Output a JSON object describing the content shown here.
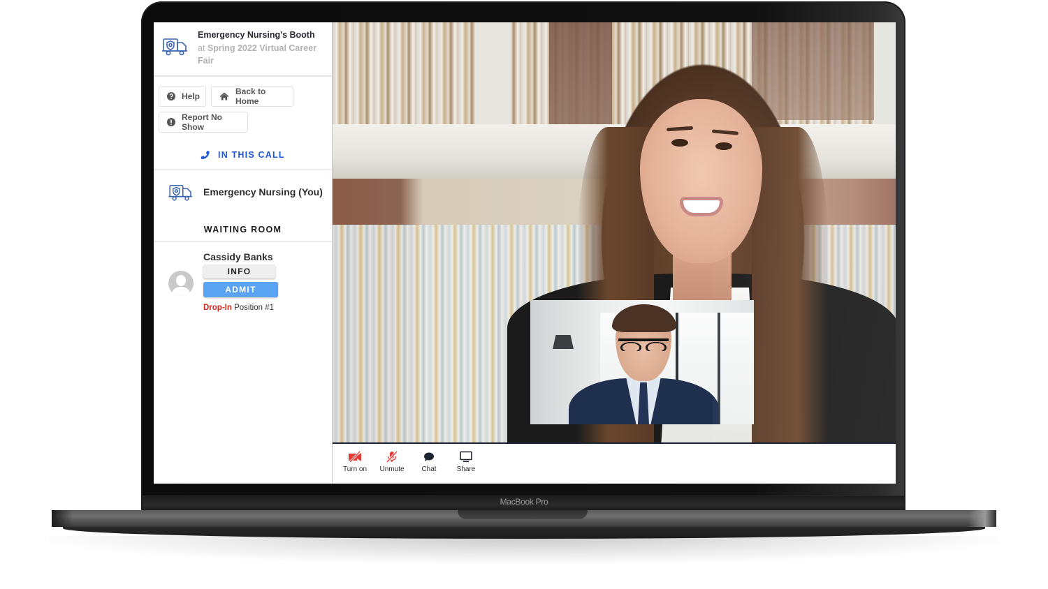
{
  "device": {
    "brand_label": "MacBook Pro"
  },
  "sidebar": {
    "booth": {
      "title": "Emergency Nursing's Booth",
      "subtitle_prefix": "at",
      "event_name": "Spring 2022 Virtual Career Fair",
      "icon": "ambulance-shield-icon"
    },
    "buttons": {
      "help": {
        "label": "Help",
        "icon": "question-circle-icon"
      },
      "home": {
        "label": "Back to Home",
        "icon": "home-icon"
      },
      "report": {
        "label": "Report No Show",
        "icon": "exclamation-circle-icon"
      }
    },
    "in_call": {
      "heading": "IN THIS CALL",
      "icon": "phone-icon",
      "participants": [
        {
          "name": "Emergency Nursing (You)",
          "icon": "ambulance-shield-icon"
        }
      ]
    },
    "waiting_room": {
      "heading": "WAITING ROOM",
      "entries": [
        {
          "name": "Cassidy Banks",
          "info_label": "INFO",
          "admit_label": "ADMIT",
          "status_tag": "Drop-In",
          "position_text": "Position #1"
        }
      ]
    }
  },
  "video": {
    "main_feed": "remote-participant-video",
    "self_view": "local-self-view-video"
  },
  "controls": [
    {
      "label": "Turn on",
      "icon": "camera-off-icon",
      "state": "off"
    },
    {
      "label": "Unmute",
      "icon": "mic-off-icon",
      "state": "off"
    },
    {
      "label": "Chat",
      "icon": "chat-bubble-icon",
      "state": "normal"
    },
    {
      "label": "Share",
      "icon": "monitor-icon",
      "state": "normal"
    }
  ],
  "colors": {
    "accent_blue": "#1e57d6",
    "admit_blue": "#5aa2f2",
    "dropin_red": "#d8281e",
    "off_red": "#e53935",
    "icon_blue": "#3a64b0"
  }
}
